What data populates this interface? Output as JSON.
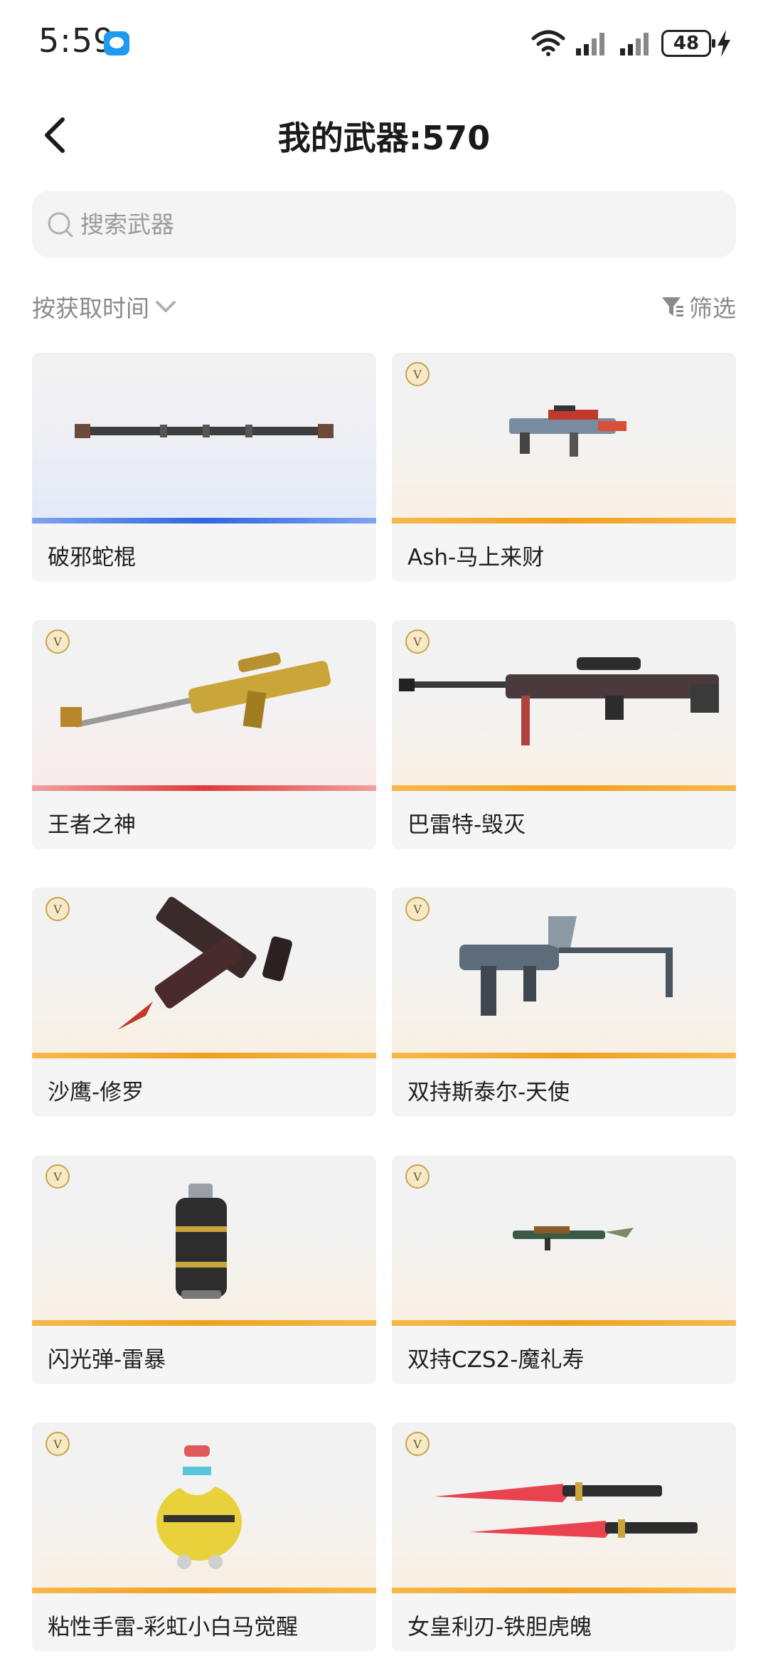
{
  "status_bar": {
    "time": "5:59",
    "battery": "48"
  },
  "header": {
    "title": "我的武器:570"
  },
  "search": {
    "placeholder": "搜索武器"
  },
  "toolbar": {
    "sort_label": "按获取时间",
    "filter_label": "筛选"
  },
  "weapons": [
    {
      "name": "破邪蛇棍",
      "rarity": "blue",
      "vip": false,
      "art": "staff-icon"
    },
    {
      "name": "Ash-马上来财",
      "rarity": "gold",
      "vip": true,
      "art": "rifle-icon"
    },
    {
      "name": "王者之神",
      "rarity": "red",
      "vip": true,
      "art": "sniper-rifle-icon"
    },
    {
      "name": "巴雷特-毁灭",
      "rarity": "gold",
      "vip": true,
      "art": "sniper-rifle-icon"
    },
    {
      "name": "沙鹰-修罗",
      "rarity": "gold",
      "vip": true,
      "art": "pistol-icon"
    },
    {
      "name": "双持斯泰尔-天使",
      "rarity": "gold",
      "vip": true,
      "art": "smg-icon"
    },
    {
      "name": "闪光弹-雷暴",
      "rarity": "gold",
      "vip": true,
      "art": "grenade-icon"
    },
    {
      "name": "双持CZS2-魔礼寿",
      "rarity": "gold",
      "vip": true,
      "art": "smg-icon"
    },
    {
      "name": "粘性手雷-彩虹小白马觉醒",
      "rarity": "gold",
      "vip": true,
      "art": "mascot-grenade-icon"
    },
    {
      "name": "女皇利刃-铁胆虎魄",
      "rarity": "gold",
      "vip": true,
      "art": "dual-blades-icon"
    }
  ],
  "colors": {
    "gold": "#f0a020",
    "blue": "#2f66e0",
    "red": "#e03b3b"
  }
}
